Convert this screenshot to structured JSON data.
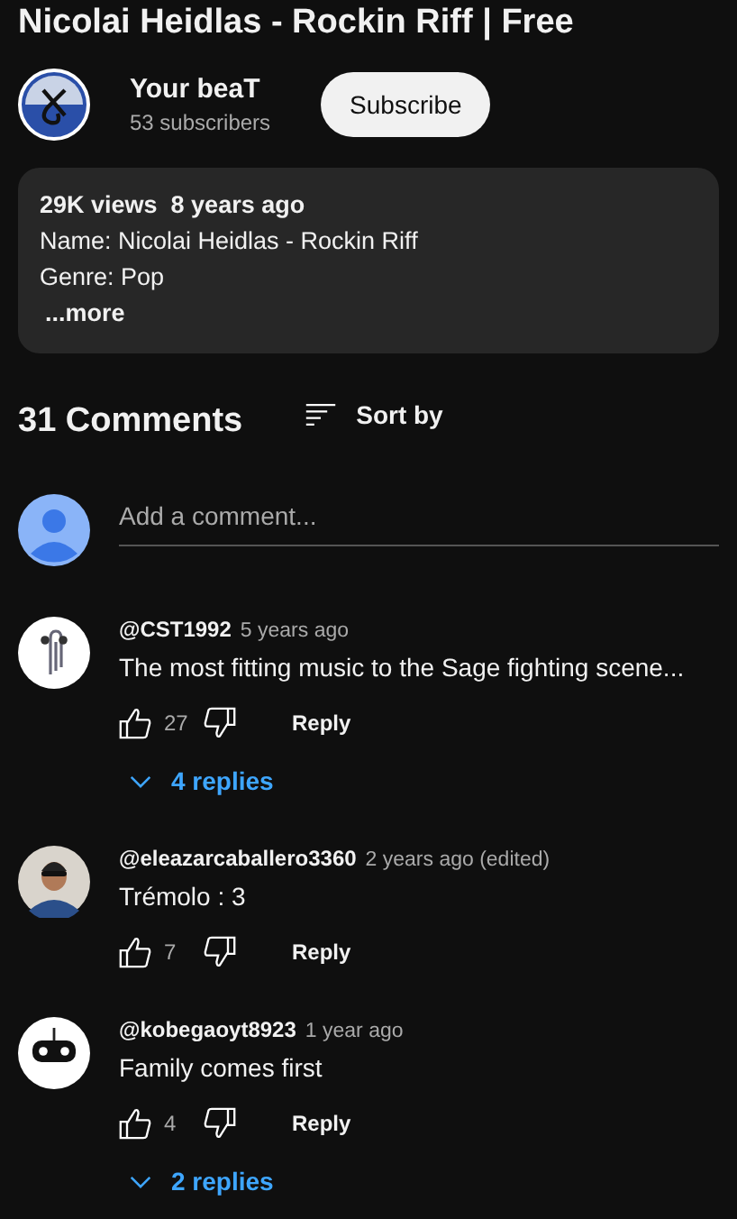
{
  "video": {
    "title": "Nicolai Heidlas - Rockin Riff | Free"
  },
  "channel": {
    "name": "Your beaT",
    "subscribers": "53 subscribers",
    "subscribe_label": "Subscribe"
  },
  "description": {
    "stats": "29K views  8 years ago",
    "lines": [
      "Name: Nicolai Heidlas - Rockin Riff",
      "Genre: Pop"
    ],
    "more": "...more"
  },
  "comments_header": {
    "count": "31 Comments",
    "sort_label": "Sort by"
  },
  "add_comment": {
    "placeholder": "Add a comment..."
  },
  "comments": [
    {
      "kind": "paperclip",
      "author": "@CST1992",
      "time": "5 years ago",
      "text": "The most fitting music to the Sage fighting scene...",
      "likes": "27",
      "reply_label": "Reply",
      "replies": "4 replies"
    },
    {
      "kind": "person",
      "author": "@eleazarcaballero3360",
      "time": "2 years ago (edited)",
      "text": "Trémolo : 3",
      "likes": "7",
      "reply_label": "Reply"
    },
    {
      "kind": "gamepad",
      "author": "@kobegaoyt8923",
      "time": "1 year ago",
      "text": "Family comes first",
      "likes": "4",
      "reply_label": "Reply",
      "replies": "2 replies"
    }
  ]
}
